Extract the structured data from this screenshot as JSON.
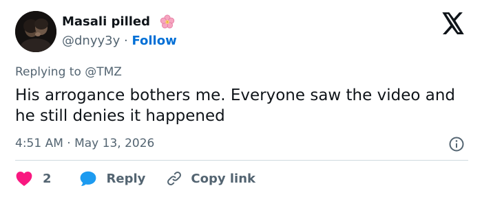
{
  "author": {
    "display_name": "Masali pilled",
    "name_emoji": "cherry-blossom-icon",
    "handle": "@dnyy3y",
    "separator": "·",
    "follow_label": "Follow"
  },
  "brand": {
    "logo": "x-logo-icon"
  },
  "reply_context": {
    "prefix": "Replying to",
    "mention": "@TMZ"
  },
  "tweet": {
    "text": "His arrogance bothers me. Everyone saw the video and he still denies it happened",
    "timestamp": "4:51 AM · May 13, 2026"
  },
  "actions": {
    "like_count": "2",
    "reply_label": "Reply",
    "copy_link_label": "Copy link"
  },
  "colors": {
    "text_primary": "#0f1419",
    "text_secondary": "#536471",
    "link_blue": "#006fd6",
    "like_pink": "#f91880",
    "reply_blue": "#1d9bf0",
    "divider": "#cfd9de"
  }
}
